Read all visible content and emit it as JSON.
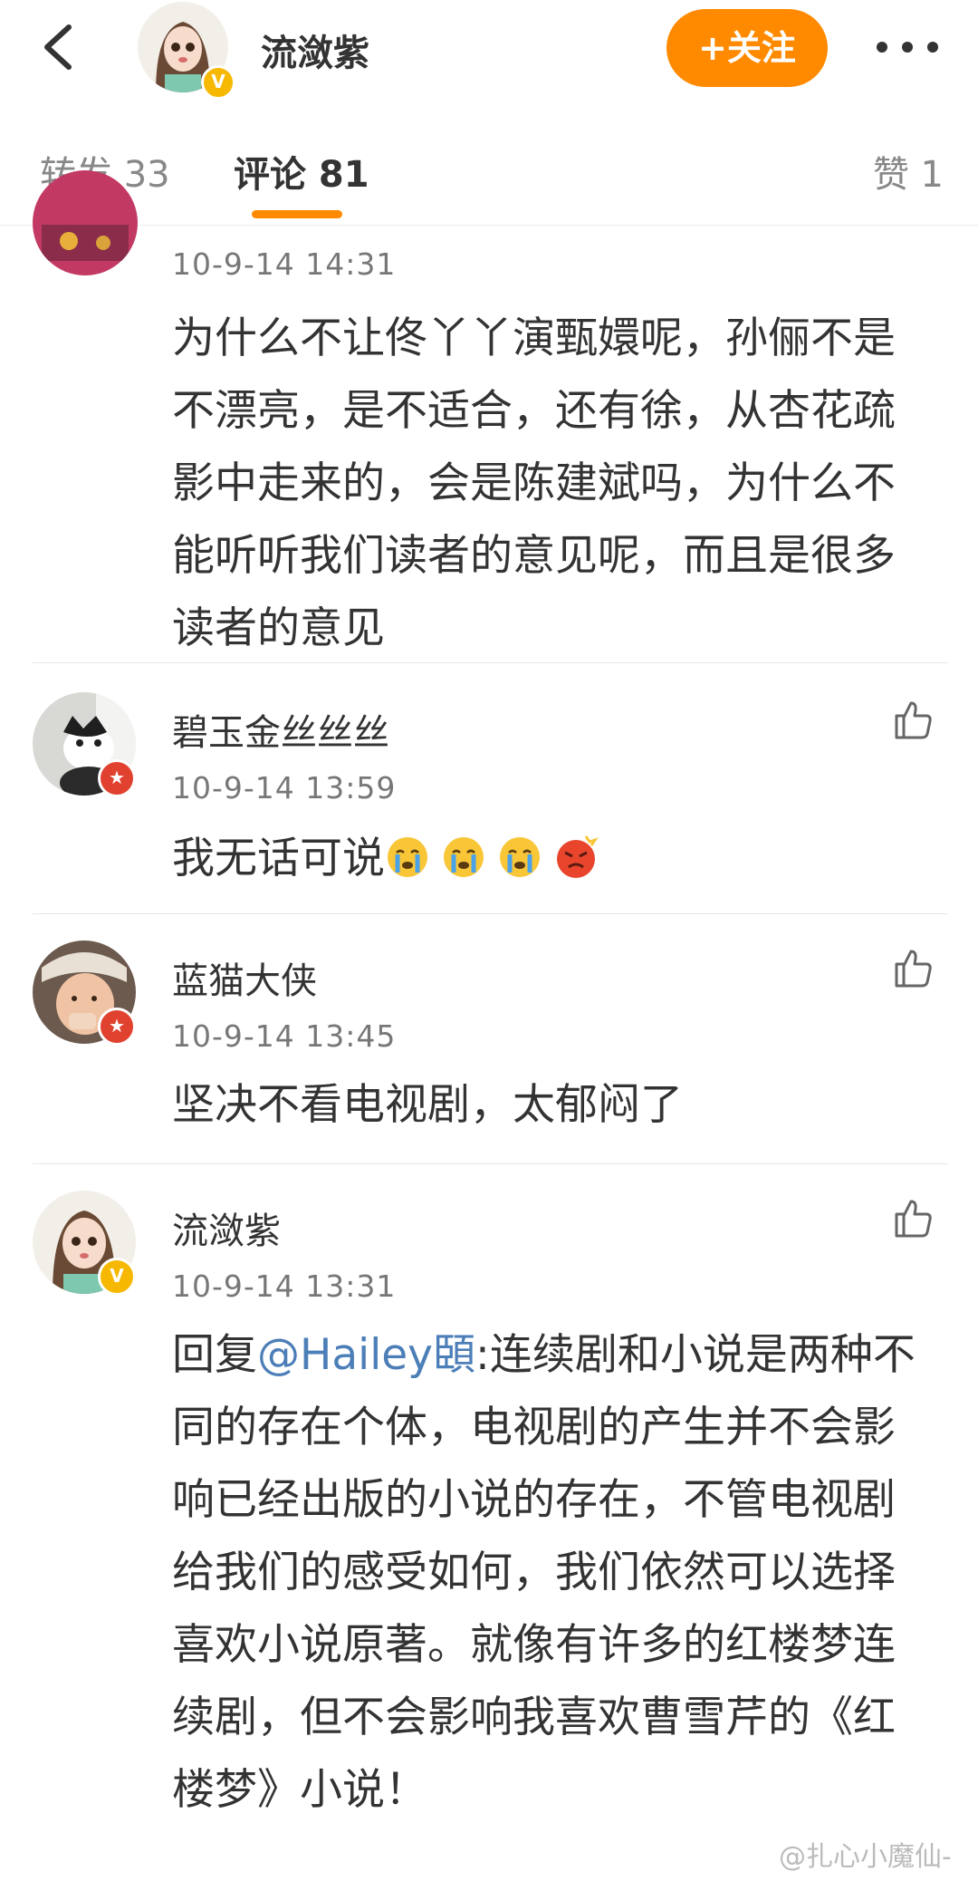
{
  "header": {
    "user_name": "流潋紫",
    "verified_badge": "V",
    "follow_label": "+关注"
  },
  "tabs": {
    "repost": "转发 33",
    "comments": "评论 81",
    "likes": "赞 1"
  },
  "comments": [
    {
      "time": "10-9-14 14:31",
      "text": "为什么不让佟丫丫演甄嬛呢，孙俪不是不漂亮，是不适合，还有徐，从杏花疏影中走来的，会是陈建斌吗，为什么不能听听我们读者的意见呢，而且是很多读者的意见"
    },
    {
      "name": "碧玉金丝丝丝",
      "time": "10-9-14 13:59",
      "text": "我无话可说",
      "emojis": [
        "crying-face-icon",
        "crying-face-icon",
        "crying-face-icon",
        "angry-face-icon"
      ]
    },
    {
      "name": "蓝猫大侠",
      "time": "10-9-14 13:45",
      "text": "坚决不看电视剧，太郁闷了"
    },
    {
      "name": "流潋紫",
      "time": "10-9-14 13:31",
      "reply_prefix": "回复",
      "mention": "@Hailey頣",
      "text": ":连续剧和小说是两种不同的存在个体，电视剧的产生并不会影响已经出版的小说的存在，不管电视剧给我们的感受如何，我们依然可以选择喜欢小说原著。就像有许多的红楼梦连续剧，但不会影响我喜欢曹雪芹的《红楼梦》小说！"
    }
  ],
  "watermark": "@扎心小魔仙-",
  "colors": {
    "accent": "#ff8a00",
    "mention": "#4c7eb8",
    "verified_gold": "#f6b800",
    "verified_red": "#e0422f"
  }
}
